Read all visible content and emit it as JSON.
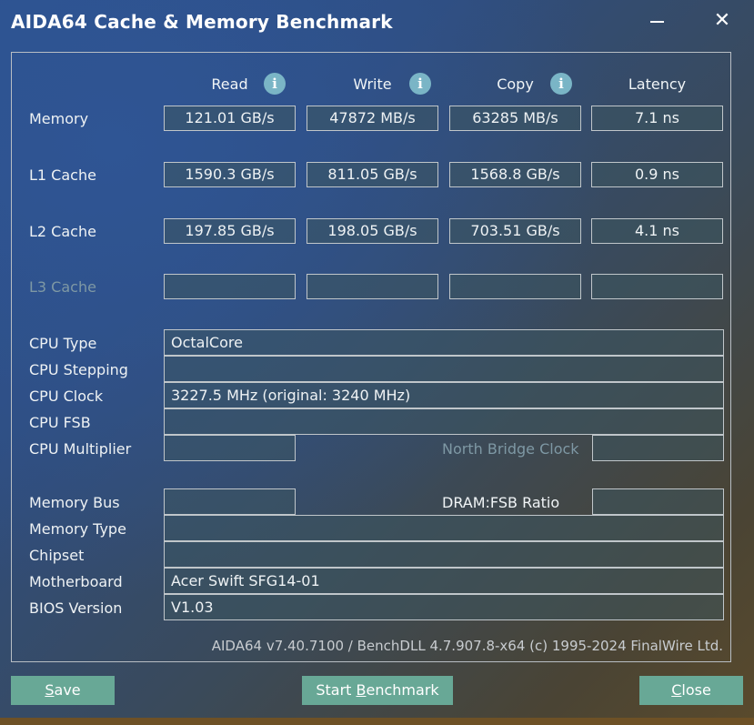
{
  "window": {
    "title": "AIDA64 Cache & Memory Benchmark",
    "minimize_icon": "minimize-icon",
    "close_icon": "close-icon"
  },
  "columns": {
    "read": "Read",
    "write": "Write",
    "copy": "Copy",
    "latency": "Latency",
    "info_glyph": "i"
  },
  "rows": {
    "memory": {
      "label": "Memory",
      "read": "121.01 GB/s",
      "write": "47872 MB/s",
      "copy": "63285 MB/s",
      "latency": "7.1 ns"
    },
    "l1": {
      "label": "L1 Cache",
      "read": "1590.3 GB/s",
      "write": "811.05 GB/s",
      "copy": "1568.8 GB/s",
      "latency": "0.9 ns"
    },
    "l2": {
      "label": "L2 Cache",
      "read": "197.85 GB/s",
      "write": "198.05 GB/s",
      "copy": "703.51 GB/s",
      "latency": "4.1 ns"
    },
    "l3": {
      "label": "L3 Cache",
      "read": "",
      "write": "",
      "copy": "",
      "latency": ""
    }
  },
  "info": {
    "cpu_type": {
      "label": "CPU Type",
      "value": "OctalCore"
    },
    "cpu_stepping": {
      "label": "CPU Stepping",
      "value": ""
    },
    "cpu_clock": {
      "label": "CPU Clock",
      "value": "3227.5 MHz  (original: 3240 MHz)"
    },
    "cpu_fsb": {
      "label": "CPU FSB",
      "value": ""
    },
    "cpu_multiplier": {
      "label": "CPU Multiplier",
      "value": ""
    },
    "north_bridge_clock": {
      "label": "North Bridge Clock",
      "value": ""
    },
    "memory_bus": {
      "label": "Memory Bus",
      "value": ""
    },
    "dram_fsb_ratio": {
      "label": "DRAM:FSB Ratio",
      "value": ""
    },
    "memory_type": {
      "label": "Memory Type",
      "value": ""
    },
    "chipset": {
      "label": "Chipset",
      "value": ""
    },
    "motherboard": {
      "label": "Motherboard",
      "value": "Acer Swift SFG14-01"
    },
    "bios_version": {
      "label": "BIOS Version",
      "value": "V1.03"
    }
  },
  "footer": "AIDA64 v7.40.7100 / BenchDLL 4.7.907.8-x64  (c) 1995-2024 FinalWire Ltd.",
  "buttons": {
    "save": {
      "accel": "S",
      "rest": "ave"
    },
    "start_pre": "Start ",
    "start_accel": "B",
    "start_rest": "enchmark",
    "close": {
      "accel": "C",
      "rest": "lose"
    }
  }
}
